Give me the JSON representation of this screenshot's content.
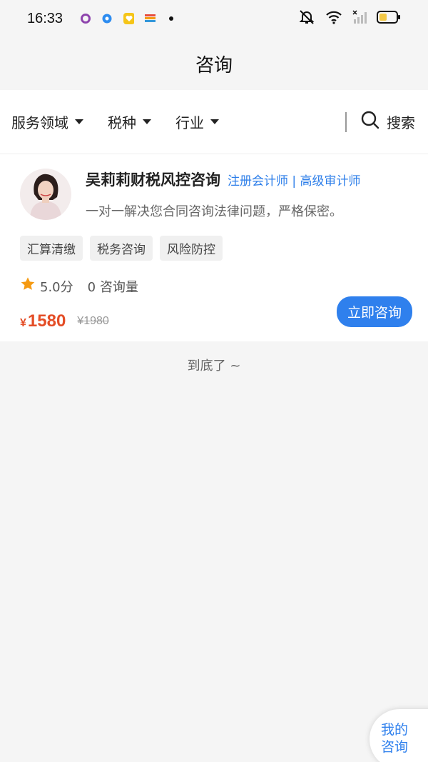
{
  "status_bar": {
    "time": "16:33",
    "app_icons": [
      "circle-app-icon",
      "blue-circle-app-icon",
      "heart-app-icon",
      "rainbow-app-icon"
    ],
    "battery_color": "#f2c744"
  },
  "header": {
    "title": "咨询"
  },
  "filters": {
    "items": [
      {
        "label": "服务领域"
      },
      {
        "label": "税种"
      },
      {
        "label": "行业"
      }
    ],
    "search_label": "搜索"
  },
  "consultant": {
    "name": "吴莉莉财税风控咨询",
    "credentials": "注册会计师 | 高级审计师",
    "description": "一对一解决您合同咨询法律问题，严格保密。",
    "tags": [
      "汇算清缴",
      "税务咨询",
      "风险防控"
    ],
    "rating": "5.0分",
    "consult_count": "0 咨询量",
    "price": "1580",
    "currency": "¥",
    "original_price": "1980",
    "button_label": "立即咨询"
  },
  "list_end_text": "到底了 ~",
  "float_button": {
    "line1": "我的",
    "line2": "咨询"
  },
  "colors": {
    "accent": "#2f80ed",
    "price": "#e44d26",
    "star": "#f59a12"
  }
}
